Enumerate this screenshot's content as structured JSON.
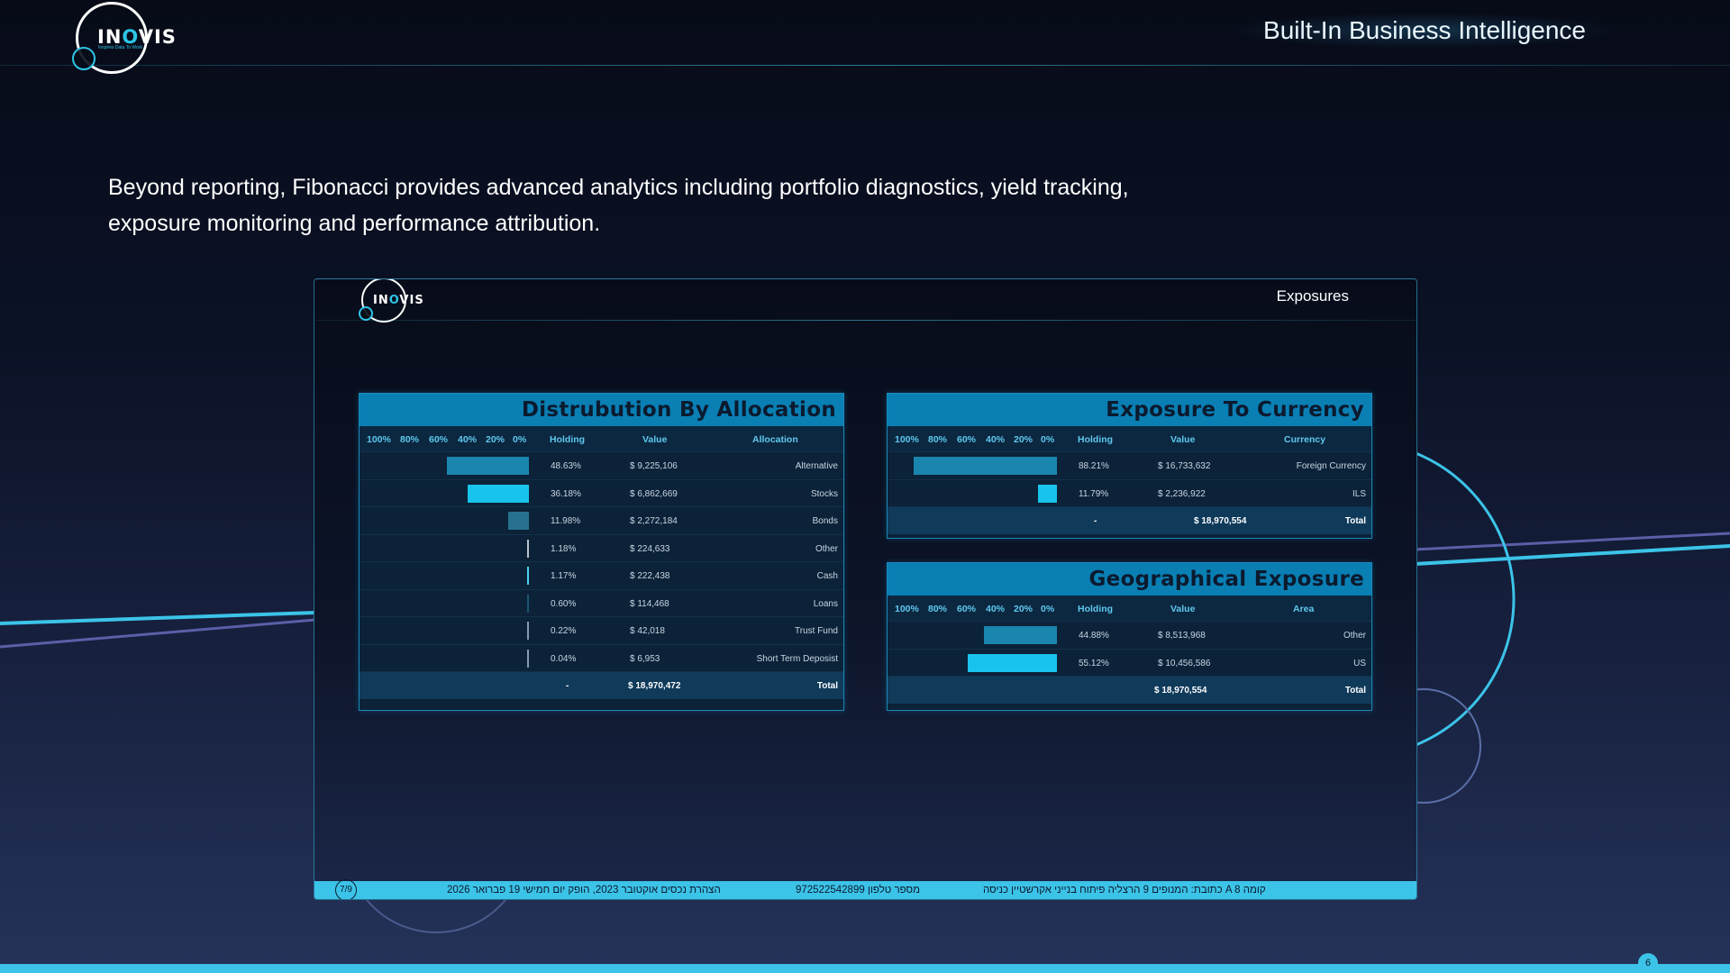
{
  "logo": {
    "text_pre": "IN",
    "text_o": "O",
    "text_post": "VIS",
    "tagline": "Inspires Data To Work"
  },
  "header": {
    "title": "Built-In Business Intelligence"
  },
  "intro": {
    "text": "Beyond reporting, Fibonacci provides advanced analytics including portfolio diagnostics, yield tracking, exposure monitoring and performance attribution."
  },
  "colors": {
    "accent": "#3cc3e8",
    "panel_header": "#0a7fb4",
    "bar_light": "#19c4ec",
    "bar_dark": "#1a86ad"
  },
  "report": {
    "title": "Exposures",
    "scale_labels": [
      "100%",
      "80%",
      "60%",
      "40%",
      "20%",
      "0%"
    ],
    "allocation": {
      "title": "Distrubution By Allocation",
      "headers": {
        "holding": "Holding",
        "value": "Value",
        "label": "Allocation"
      },
      "rows": [
        {
          "pct": "48.63%",
          "fraction": 0.4863,
          "value": "$ 9,225,106",
          "label": "Alternative",
          "color": "#1a86ad"
        },
        {
          "pct": "36.18%",
          "fraction": 0.3618,
          "value": "$ 6,862,669",
          "label": "Stocks",
          "color": "#19c4ec"
        },
        {
          "pct": "11.98%",
          "fraction": 0.1198,
          "value": "$ 2,272,184",
          "label": "Bonds",
          "color": "#27708f"
        },
        {
          "pct": "1.18%",
          "fraction": 0.0118,
          "value": "$ 224,633",
          "label": "Other",
          "color": "#b9c3cc"
        },
        {
          "pct": "1.17%",
          "fraction": 0.0117,
          "value": "$ 222,438",
          "label": "Cash",
          "color": "#4fd2ee"
        },
        {
          "pct": "0.60%",
          "fraction": 0.006,
          "value": "$ 114,468",
          "label": "Loans",
          "color": "#1c5574"
        },
        {
          "pct": "0.22%",
          "fraction": 0.0022,
          "value": "$ 42,018",
          "label": "Trust Fund",
          "color": "#8a99a8"
        },
        {
          "pct": "0.04%",
          "fraction": 0.0004,
          "value": "$ 6,953",
          "label": "Short Term Deposist",
          "color": "#8a99a8"
        }
      ],
      "total": {
        "pct": "-",
        "value": "$ 18,970,472",
        "label": "Total"
      }
    },
    "currency": {
      "title": "Exposure To Currency",
      "headers": {
        "holding": "Holding",
        "value": "Value",
        "label": "Currency"
      },
      "rows": [
        {
          "pct": "88.21%",
          "fraction": 0.8821,
          "value": "$ 16,733,632",
          "label": "Foreign Currency",
          "color": "#1a86ad"
        },
        {
          "pct": "11.79%",
          "fraction": 0.1179,
          "value": "$ 2,236,922",
          "label": "ILS",
          "color": "#19c4ec"
        }
      ],
      "total": {
        "pct": "-",
        "value": "$ 18,970,554",
        "label": "Total"
      }
    },
    "geo": {
      "title": "Geographical Exposure",
      "headers": {
        "holding": "Holding",
        "value": "Value",
        "label": "Area"
      },
      "rows": [
        {
          "pct": "44.88%",
          "fraction": 0.4488,
          "value": "$ 8,513,968",
          "label": "Other",
          "color": "#1a86ad"
        },
        {
          "pct": "55.12%",
          "fraction": 0.5512,
          "value": "$ 10,456,586",
          "label": "US",
          "color": "#19c4ec"
        }
      ],
      "total": {
        "pct": "",
        "value": "$ 18,970,554",
        "label": "Total"
      }
    },
    "footer": {
      "page": "7/9",
      "date_text": "הצהרת נכסים אוקטובר 2023, הופק יום חמישי 19 פברואר 2026",
      "phone_text": "972522542899 מספר טלפון",
      "address_text": "כתובת: המנופים 9 הרצליה פיתוח בנייני אקרשטיין כניסה A קומה 8"
    }
  },
  "slide": {
    "number": "6"
  }
}
